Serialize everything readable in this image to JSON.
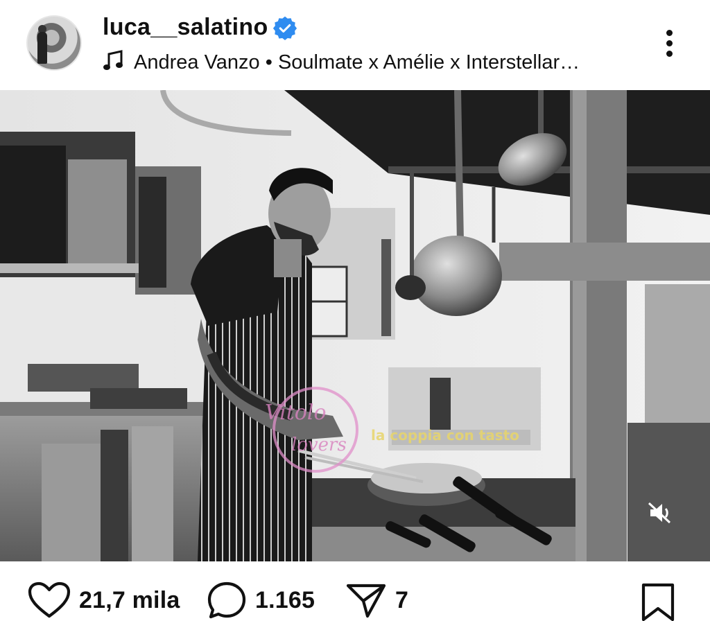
{
  "header": {
    "username": "luca__salatino",
    "verified": true,
    "music": {
      "artist": "Andrea Vanzo",
      "separator": "•",
      "track": "Soulmate x Amélie x Interstellar…"
    },
    "icons": [
      "avatar",
      "verified-badge-icon",
      "music-note-icon",
      "more-options-icon"
    ]
  },
  "post": {
    "media_type": "video",
    "description_visible": false,
    "watermark": "Vitolo Lovers / la coppia con tasto",
    "muted": true
  },
  "actions": {
    "likes": "21,7 mila",
    "comments": "1.165",
    "shares": "7"
  },
  "colors": {
    "verified_blue": "#2f8cf0",
    "text": "#111111",
    "background": "#ffffff"
  }
}
